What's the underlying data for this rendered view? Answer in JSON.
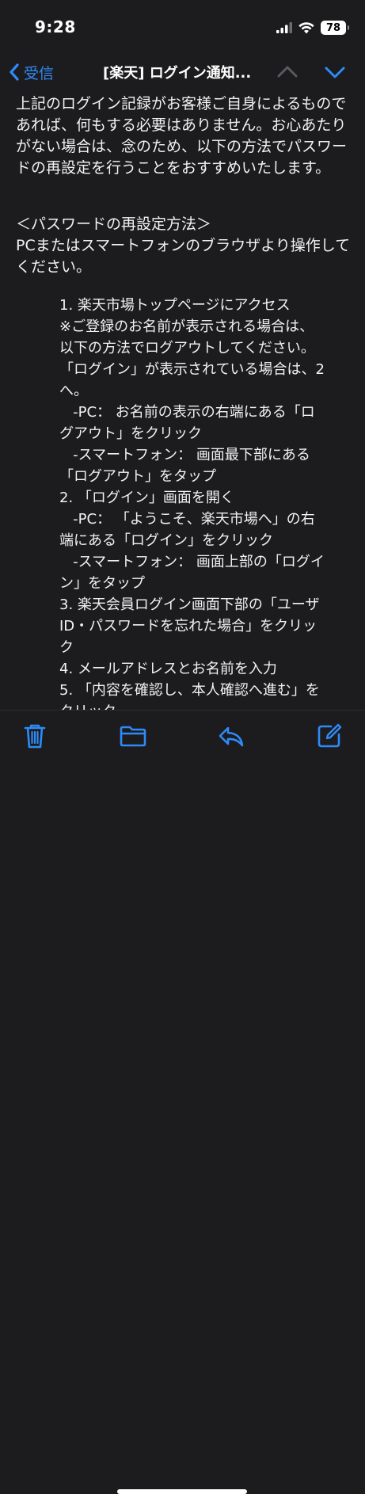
{
  "status_bar": {
    "time": "9:28",
    "battery": "78"
  },
  "nav": {
    "back_label": "受信",
    "title": "[楽天] ログイン通知...",
    "up_icon": "chevron-up-icon",
    "down_icon": "chevron-down-icon"
  },
  "body": {
    "paragraph1": "上記のログイン記録がお客様ご自身によるものであれば、何もする必要はありません。お心あたりがない場合は、念のため、以下の方法でパスワードの再設定を行うことをおすすめいたします。",
    "section_heading": "＜パスワードの再設定方法＞",
    "section_intro": "PCまたはスマートフォンのブラウザより操作してください。",
    "steps": [
      "1. 楽天市場トップページにアクセス",
      "※ご登録のお名前が表示される場合は、",
      "以下の方法でログアウトしてください。",
      "「ログイン」が表示されている場合は、2",
      "へ。",
      "   -PC： お名前の表示の右端にある「ロ",
      "グアウト」をクリック",
      "   -スマートフォン： 画面最下部にある",
      "「ログアウト」をタップ",
      "2. 「ログイン」画面を開く",
      "   -PC： 「ようこそ、楽天市場へ」の右",
      "端にある「ログイン」をクリック",
      "   -スマートフォン： 画面上部の「ログイ",
      "ン」をタップ",
      "3. 楽天会員ログイン画面下部の「ユーザ",
      "ID・パスワードを忘れた場合」をクリッ",
      "ク",
      "4. メールアドレスとお名前を入力",
      "5. 「内容を確認し、本人確認へ進む」を",
      "クリック"
    ]
  },
  "toolbar": {
    "icons": [
      "trash-icon",
      "folder-icon",
      "reply-icon",
      "compose-icon"
    ]
  },
  "colors": {
    "background": "#1c1c1e",
    "accent": "#2f8af7",
    "text": "#f2f2f2"
  }
}
